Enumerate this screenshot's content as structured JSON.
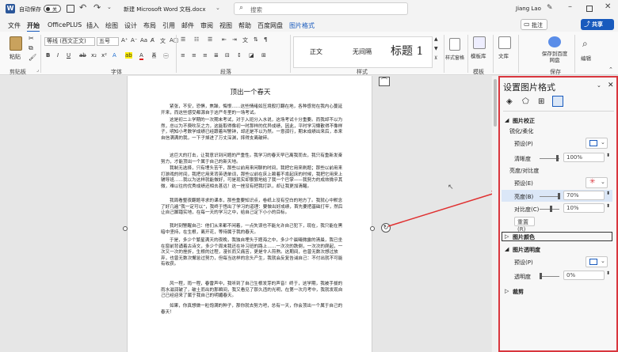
{
  "titlebar": {
    "autosave_label": "自动保存",
    "autosave_state": "关",
    "doc_title": "新建 Microsoft Word 文档.docx",
    "search_placeholder": "搜索",
    "user_name": "Jiang Lao"
  },
  "menu": {
    "items": [
      "文件",
      "开始",
      "OfficePLUS",
      "插入",
      "绘图",
      "设计",
      "布局",
      "引用",
      "邮件",
      "审阅",
      "视图",
      "帮助",
      "百度网盘",
      "图片格式"
    ],
    "active_index": 1,
    "comment_label": "批注",
    "share_label": "共享"
  },
  "ribbon": {
    "paste_label": "粘贴",
    "clipboard_label": "剪贴板",
    "font_name": "等线 (西文正文)",
    "font_size": "五号",
    "font_group_label": "字体",
    "paragraph_group_label": "段落",
    "styles": [
      "正文",
      "无间隔",
      "标题 1"
    ],
    "style_group_label": "样式",
    "styles_pane_label": "样式窗格",
    "template_label": "模板库",
    "template_group_label": "模板",
    "doc_label": "文库",
    "save_label": "保存到百度网盘",
    "save_group_label": "保存",
    "edit_label": "编辑"
  },
  "document": {
    "title": "顶出一个春天",
    "paragraphs": [
      "紧张，不安，恐惧，焦躁，悔恨……这些情绪如压境般打翻在地，各种感觉在我内心蔓延开来，而这些感受都源自于这严冬里的一场考试。",
      "这是初二上学期的一次期末考试，对于入班分入水说，这场考试十分重要。而我却不以为然，总以为不费吹灰之力，这能取得像初一时那样的优异成绩，因此，平时学习懒散得不像样子，明知小考数学成绩已经跟着叫警钟，却还是不以为然。一意孤行，期末成绩出来后，本来自信满满的我，一下子掉进了万丈深渊，摔得支离破碎。",
      "这巨大的打击，让我意识到问题的严重性。我学习的春天早已离我而去，我只有重新发奋努力，才能顶出一个属于自己的新天地。",
      "我制无选择，只有埋头苦干，那些以前用来闲聊的时间，我把它用来刷题；那些以前用来打游戏的时间，我把它用来背英语单词，那些以前在床上赖着不肯起床的时候，我把它用来上辅导班……我以为这样就能做好，可是现实却狠狠地给了我一个巴掌——我努力的成效微乎其微，难以往的优秀成绩还相去甚远！这一挫没有把我打趴，却让我更加清醒。",
      "我周看整夜翻题寻求的课本，那些重要知识点，卷纸上没有空白的地方了。我就心中默念了好几遍“我一定可以”，我终于悟出了学习的道理：要做出好成绩，首先要把基础打牢，然后让自己脚踏实地，在每一天的学习之中，给自己定下小小的目标。",
      "我时刻警醒自己：他们从来都不闲着，一点失误也不能允许自己犯下，现在，我只能在黑暗中坚持，在生根，离开花，等待属于我的春天。",
      "于是，多少个繁星满天的夜晚，我独自埋头于题海之中，多少个晨曦微露的清晨，我已坐在窗前背诵着古诗文，多少个周末我还在补习班的路上……一次次的跌倒，一次次的爬起，一次又一次的挫折，生根的过程，漫长而又痛苦，更是令人煎熬。这期间，也曾无数次想过放弃，也曾无数次懈怠过努力，但每当这样的念头产生，我就会反复告诫自己：不付出就不可能有收获。",
      "风一程，雨一程，春雷声中，我听到了自己生根发芽的声音！终于，这学期，我被手拔的雨水滋润破了，破土而出的那瞬间，我又看见了那久违的光明，在第一次月考中，我就发现自己已经迎来了属于我自己的明媚春天。",
      "如果，你真想做一粒饱满的种子，那你就去努力吧，总有一天，你会顶出一个属于自己的春天！"
    ]
  },
  "pane": {
    "title": "设置图片格式",
    "section_correction": "图片校正",
    "sharpen_label": "锐化/柔化",
    "preset_label": "预设(P)",
    "clarity_label": "清晰度",
    "clarity_value": "100%",
    "brightness_contrast_label": "亮度/对比度",
    "preset2_label": "预设(E)",
    "brightness_label": "亮度(B)",
    "brightness_value": "70%",
    "contrast_label": "对比度(C)",
    "contrast_value": "10%",
    "reset_label": "重置(R)",
    "section_color": "图片颜色",
    "section_transparency": "图片透明度",
    "preset3_label": "预设(P)",
    "transparency_label": "透明度",
    "transparency_value": "0%",
    "section_crop": "裁剪",
    "brightness_fraction": 0.7,
    "contrast_fraction": 0.55,
    "clarity_fraction": 0.5,
    "transparency_fraction": 0.0
  },
  "colors": {
    "accent": "#185abd",
    "highlight": "#d9363e",
    "arrow": "#e03030"
  }
}
